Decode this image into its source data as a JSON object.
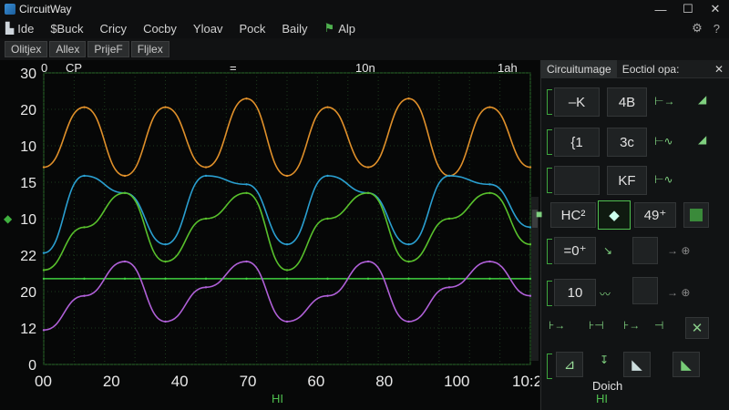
{
  "window": {
    "title": "CircuitWay",
    "controls": [
      "—",
      "☐",
      "✕"
    ]
  },
  "menu": {
    "items": [
      {
        "label": "Ide",
        "icon": "file-icon"
      },
      {
        "label": "$Buck"
      },
      {
        "label": "Cricy"
      },
      {
        "label": "Cocby"
      },
      {
        "label": "Yloav"
      },
      {
        "label": "Pock"
      },
      {
        "label": "Baily"
      },
      {
        "label": "Alp",
        "icon": "flag-icon"
      }
    ]
  },
  "toolbar": {
    "tabs": [
      "Olitjex",
      "Allex",
      "PrijeF",
      "Fljlex"
    ]
  },
  "plot": {
    "header": {
      "left_num": "0",
      "left_label": "CP",
      "mid": "=",
      "right_mid": "10n",
      "right": "1ah"
    },
    "y_ticks": [
      "30",
      "20",
      "10",
      "15",
      "10",
      "22",
      "20",
      "12",
      "0"
    ],
    "x_ticks": [
      "00",
      "20",
      "40",
      "70",
      "60",
      "80",
      "100",
      "10:2"
    ],
    "footer_label": "HI",
    "left_marker": "◆"
  },
  "chart_data": {
    "type": "line",
    "x": [
      0,
      10,
      20,
      30,
      40,
      50,
      60,
      70,
      80,
      90,
      100,
      110,
      120
    ],
    "xlabel": "",
    "ylabel": "",
    "grid": true,
    "series": [
      {
        "values": [
          15,
          22,
          14,
          22,
          15,
          23,
          14,
          22,
          15,
          23,
          14,
          22,
          15
        ],
        "color": "#e0902a"
      },
      {
        "values": [
          5,
          14,
          12,
          6,
          14,
          13,
          6,
          14,
          12,
          6,
          14,
          13,
          8
        ],
        "color": "#2a9fd0"
      },
      {
        "values": [
          3,
          8,
          12,
          4,
          9,
          12,
          3,
          9,
          12,
          4,
          9,
          12,
          6
        ],
        "color": "#58c02c"
      },
      {
        "values": [
          2,
          2,
          2,
          2,
          2,
          2,
          2,
          2,
          2,
          2,
          2,
          2,
          2
        ],
        "color": "#3fd03f"
      },
      {
        "values": [
          -4,
          0,
          4,
          -3,
          1,
          4,
          -3,
          0,
          4,
          -3,
          1,
          4,
          0
        ],
        "color": "#b060d8"
      }
    ]
  },
  "panel": {
    "tabs": [
      "Circuitumage",
      "Eoctiol opa:"
    ],
    "close": "✕",
    "buttons": [
      {
        "label": "–K"
      },
      {
        "label": "4B"
      },
      {
        "label": "{1"
      },
      {
        "label": "3c"
      },
      {
        "label": ""
      },
      {
        "label": "KF"
      },
      {
        "label": "HC²"
      },
      {
        "label": "49⁺"
      },
      {
        "label": "=0⁺"
      },
      {
        "label": "10"
      }
    ],
    "footer_label": "Doich",
    "bottom_label": "HI"
  },
  "colors": {
    "accent": "#4fbf4f",
    "grid": "#1c3a1c",
    "axis": "#2f8f2f"
  }
}
